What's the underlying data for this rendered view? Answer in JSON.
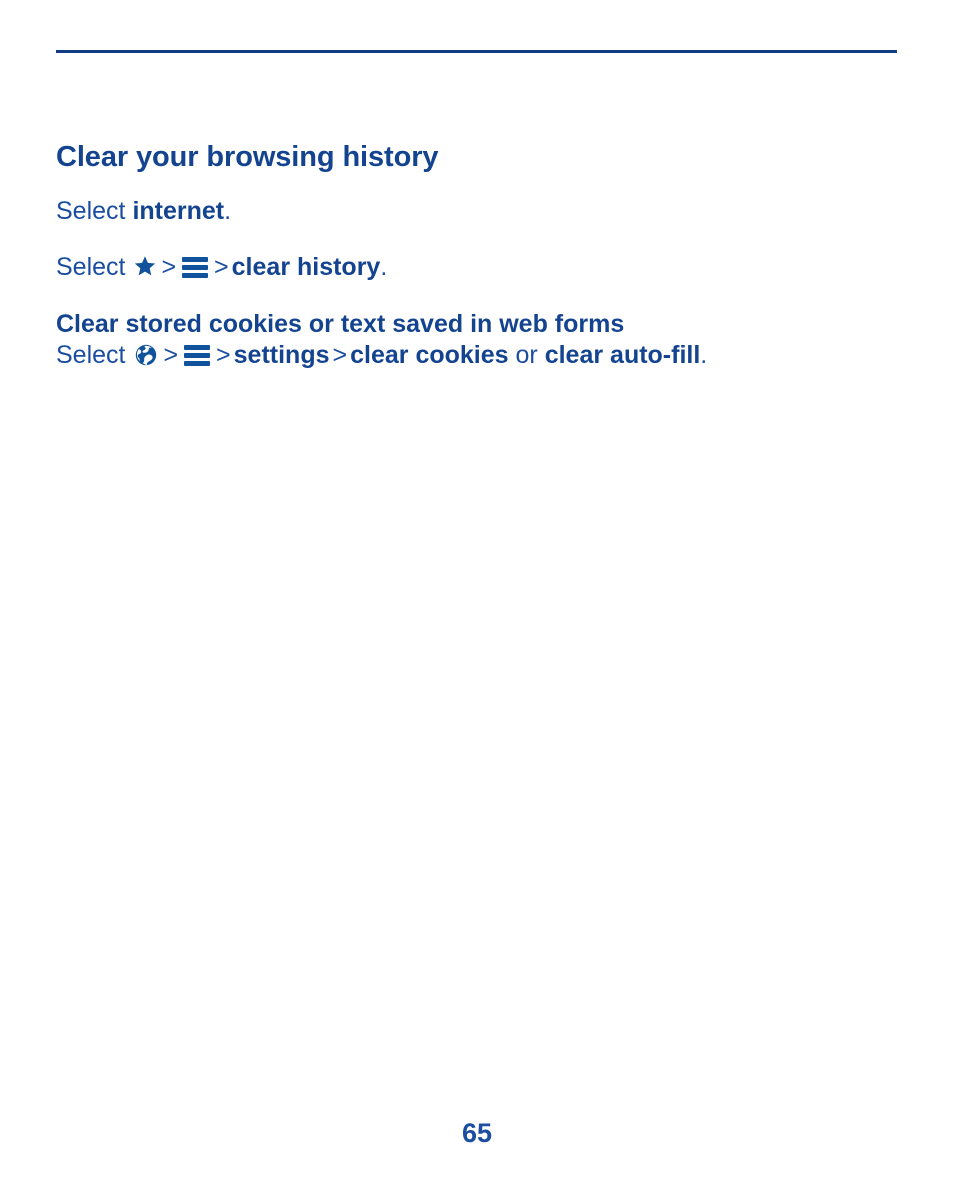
{
  "page": {
    "number": "65",
    "rule_color": "#123c82",
    "text_color": "#14448f",
    "body_color": "#1b4ea0"
  },
  "sections": [
    {
      "heading": "Clear your browsing history",
      "steps": [
        {
          "lead": "Select",
          "term1": "internet",
          "period": "."
        },
        {
          "lead": "Select",
          "icon1": "star-icon",
          "sep1": ">",
          "icon2": "menu-icon",
          "sep2": ">",
          "term1": "clear history",
          "period": "."
        }
      ]
    },
    {
      "heading": "Clear stored cookies or text saved in web forms",
      "steps": [
        {
          "lead": "Select",
          "icon1": "globe-icon",
          "sep1": ">",
          "icon2": "menu-icon",
          "sep2": ">",
          "term1": "settings",
          "sep3": ">",
          "term2": "clear cookies",
          "conjunction": "or",
          "term3": "clear auto-fill",
          "period": "."
        }
      ]
    }
  ]
}
